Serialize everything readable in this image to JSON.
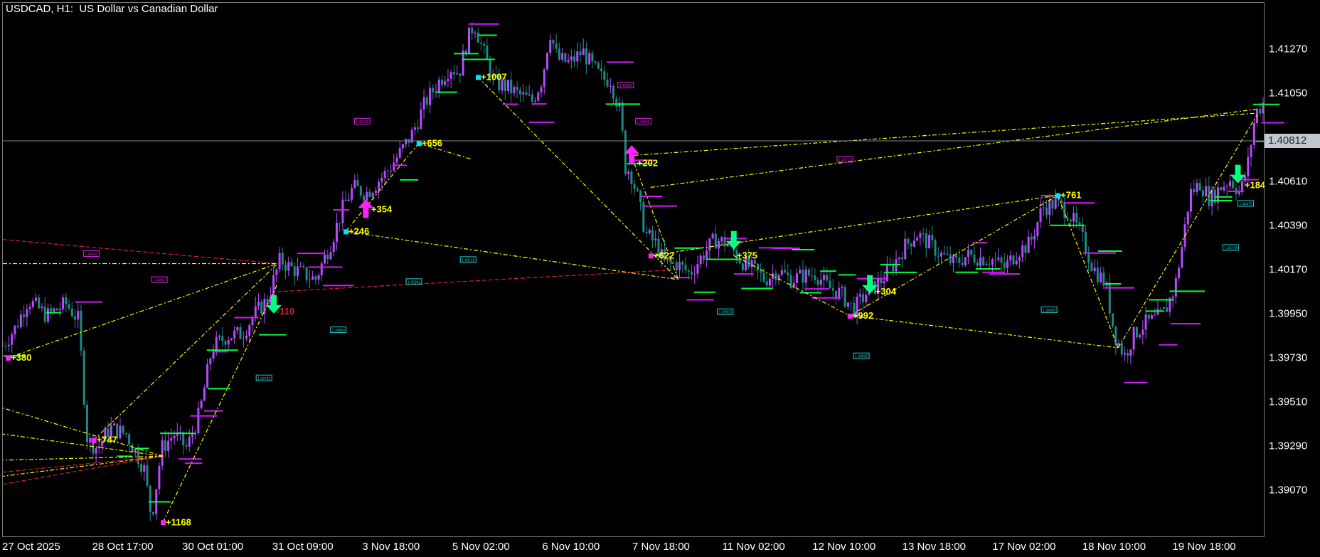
{
  "header": {
    "title": "USDCAD, H1:  US Dollar vs Canadian Dollar"
  },
  "colors": {
    "background": "#000000",
    "bull_candle": "#b44bff",
    "bear_candle": "#1f8a84",
    "zigzag": "#ffff00",
    "trend_red": "#d21e3c",
    "buy_level": "#00ff3c",
    "sell_level": "#d218ff",
    "signal_up": "#ff22ff",
    "signal_down": "#00ff7f",
    "label_text": "#ffff00",
    "current_price_line": "#778899"
  },
  "chart_data": {
    "type": "candlestick",
    "symbol": "USDCAD",
    "timeframe": "H1",
    "y_ticks": [
      "1.41270",
      "1.41050",
      "1.40610",
      "1.40390",
      "1.40170",
      "1.39950",
      "1.39730",
      "1.39510",
      "1.39290",
      "1.39070"
    ],
    "current_price": "1.40812",
    "x_ticks": [
      "27 Oct 2025",
      "28 Oct 17:00",
      "30 Oct 01:00",
      "31 Oct 09:00",
      "3 Nov 18:00",
      "5 Nov 02:00",
      "6 Nov 10:00",
      "7 Nov 18:00",
      "11 Nov 02:00",
      "12 Nov 10:00",
      "13 Nov 18:00",
      "17 Nov 02:00",
      "18 Nov 10:00",
      "19 Nov 18:00"
    ],
    "ylim": [
      1.3884,
      1.415
    ],
    "price_path": [
      [
        0,
        1.3979
      ],
      [
        0.01,
        1.3988
      ],
      [
        0.02,
        1.4002
      ],
      [
        0.035,
        1.3994
      ],
      [
        0.05,
        1.4
      ],
      [
        0.06,
        1.3992
      ],
      [
        0.067,
        1.3932
      ],
      [
        0.075,
        1.3928
      ],
      [
        0.085,
        1.3938
      ],
      [
        0.098,
        1.3935
      ],
      [
        0.112,
        1.3918
      ],
      [
        0.118,
        1.3893
      ],
      [
        0.126,
        1.3928
      ],
      [
        0.136,
        1.3935
      ],
      [
        0.146,
        1.3928
      ],
      [
        0.156,
        1.3945
      ],
      [
        0.166,
        1.3978
      ],
      [
        0.178,
        1.3984
      ],
      [
        0.19,
        1.3985
      ],
      [
        0.2,
        1.3995
      ],
      [
        0.21,
        1.4002
      ],
      [
        0.22,
        1.4022
      ],
      [
        0.228,
        1.4018
      ],
      [
        0.238,
        1.4015
      ],
      [
        0.248,
        1.4012
      ],
      [
        0.26,
        1.403
      ],
      [
        0.27,
        1.4048
      ],
      [
        0.278,
        1.4058
      ],
      [
        0.288,
        1.4055
      ],
      [
        0.296,
        1.406
      ],
      [
        0.305,
        1.4066
      ],
      [
        0.315,
        1.4075
      ],
      [
        0.325,
        1.4085
      ],
      [
        0.335,
        1.41
      ],
      [
        0.345,
        1.411
      ],
      [
        0.355,
        1.4118
      ],
      [
        0.362,
        1.4115
      ],
      [
        0.368,
        1.413
      ],
      [
        0.374,
        1.414
      ],
      [
        0.38,
        1.4128
      ],
      [
        0.39,
        1.411
      ],
      [
        0.4,
        1.4108
      ],
      [
        0.41,
        1.4104
      ],
      [
        0.42,
        1.4101
      ],
      [
        0.428,
        1.4112
      ],
      [
        0.434,
        1.4136
      ],
      [
        0.44,
        1.4122
      ],
      [
        0.45,
        1.412
      ],
      [
        0.46,
        1.4126
      ],
      [
        0.468,
        1.4118
      ],
      [
        0.476,
        1.4112
      ],
      [
        0.482,
        1.4112
      ],
      [
        0.49,
        1.4095
      ],
      [
        0.494,
        1.4068
      ],
      [
        0.498,
        1.4066
      ],
      [
        0.504,
        1.4052
      ],
      [
        0.51,
        1.4035
      ],
      [
        0.518,
        1.403
      ],
      [
        0.525,
        1.402
      ],
      [
        0.535,
        1.402
      ],
      [
        0.545,
        1.4015
      ],
      [
        0.555,
        1.4024
      ],
      [
        0.565,
        1.4032
      ],
      [
        0.575,
        1.403
      ],
      [
        0.585,
        1.4022
      ],
      [
        0.595,
        1.4017
      ],
      [
        0.605,
        1.4012
      ],
      [
        0.615,
        1.4017
      ],
      [
        0.625,
        1.4012
      ],
      [
        0.635,
        1.4014
      ],
      [
        0.645,
        1.4015
      ],
      [
        0.655,
        1.4008
      ],
      [
        0.665,
        1.4005
      ],
      [
        0.675,
        1.3997
      ],
      [
        0.685,
        1.4005
      ],
      [
        0.695,
        1.401
      ],
      [
        0.705,
        1.4018
      ],
      [
        0.715,
        1.4028
      ],
      [
        0.725,
        1.4035
      ],
      [
        0.735,
        1.403
      ],
      [
        0.745,
        1.4024
      ],
      [
        0.755,
        1.402
      ],
      [
        0.765,
        1.4024
      ],
      [
        0.775,
        1.4023
      ],
      [
        0.785,
        1.4022
      ],
      [
        0.795,
        1.4018
      ],
      [
        0.805,
        1.4026
      ],
      [
        0.815,
        1.403
      ],
      [
        0.825,
        1.4048
      ],
      [
        0.835,
        1.405
      ],
      [
        0.845,
        1.4046
      ],
      [
        0.855,
        1.4035
      ],
      [
        0.865,
        1.4018
      ],
      [
        0.875,
        1.401
      ],
      [
        0.882,
        1.3985
      ],
      [
        0.89,
        1.3974
      ],
      [
        0.898,
        1.3985
      ],
      [
        0.906,
        1.399
      ],
      [
        0.914,
        1.3992
      ],
      [
        0.922,
        1.3996
      ],
      [
        0.93,
        1.4008
      ],
      [
        0.936,
        1.403
      ],
      [
        0.942,
        1.4055
      ],
      [
        0.95,
        1.406
      ],
      [
        0.958,
        1.4052
      ],
      [
        0.966,
        1.4058
      ],
      [
        0.974,
        1.4062
      ],
      [
        0.982,
        1.4055
      ],
      [
        0.988,
        1.407
      ],
      [
        0.994,
        1.4095
      ],
      [
        1.0,
        1.41
      ]
    ],
    "zigzag_labels": [
      {
        "text": "+380",
        "x": 0.004,
        "y": 1.3973,
        "marker": "magenta"
      },
      {
        "text": "+747",
        "x": 0.072,
        "y": 1.3932,
        "marker": "magenta"
      },
      {
        "text": "+1168",
        "x": 0.127,
        "y": 1.3891,
        "marker": "magenta"
      },
      {
        "text": "-110",
        "x": 0.215,
        "y": 1.3996,
        "marker": "none"
      },
      {
        "text": "+246",
        "x": 0.272,
        "y": 1.4036,
        "marker": "cyan"
      },
      {
        "text": "+354",
        "x": 0.29,
        "y": 1.4047,
        "marker": "none"
      },
      {
        "text": "+656",
        "x": 0.33,
        "y": 1.408,
        "marker": "cyan"
      },
      {
        "text": "+1007",
        "x": 0.377,
        "y": 1.4113,
        "marker": "cyan"
      },
      {
        "text": "+202",
        "x": 0.501,
        "y": 1.407,
        "marker": "none"
      },
      {
        "text": "+622",
        "x": 0.514,
        "y": 1.4024,
        "marker": "magenta"
      },
      {
        "text": "+375",
        "x": 0.58,
        "y": 1.4024,
        "marker": "none"
      },
      {
        "text": "+992",
        "x": 0.672,
        "y": 1.3994,
        "marker": "magenta"
      },
      {
        "text": "+304",
        "x": 0.69,
        "y": 1.4006,
        "marker": "none"
      },
      {
        "text": "+761",
        "x": 0.837,
        "y": 1.4054,
        "marker": "cyan"
      },
      {
        "text": "+184",
        "x": 0.983,
        "y": 1.4059,
        "marker": "none"
      }
    ],
    "zigzag_lines": [
      [
        [
          0.004,
          1.3973
        ],
        [
          0.218,
          1.402
        ]
      ],
      [
        [
          0.072,
          1.3932
        ],
        [
          0.218,
          1.402
        ]
      ],
      [
        [
          0.127,
          1.3891
        ],
        [
          0.218,
          1.401
        ]
      ],
      [
        [
          0.127,
          1.3924
        ],
        [
          0.0,
          1.3948
        ]
      ],
      [
        [
          0.127,
          1.3924
        ],
        [
          0.0,
          1.3935
        ]
      ],
      [
        [
          0.127,
          1.3924
        ],
        [
          0.0,
          1.3922
        ]
      ],
      [
        [
          0.127,
          1.3924
        ],
        [
          0.0,
          1.3914
        ]
      ],
      [
        [
          0.0,
          1.402
        ],
        [
          0.218,
          1.402
        ]
      ],
      [
        [
          0.272,
          1.4036
        ],
        [
          0.536,
          1.4012
        ]
      ],
      [
        [
          0.33,
          1.408
        ],
        [
          0.372,
          1.4072
        ]
      ],
      [
        [
          0.33,
          1.408
        ],
        [
          0.272,
          1.4036
        ]
      ],
      [
        [
          0.377,
          1.4113
        ],
        [
          0.536,
          1.4012
        ]
      ],
      [
        [
          0.501,
          1.407
        ],
        [
          0.536,
          1.4012
        ]
      ],
      [
        [
          0.501,
          1.4074
        ],
        [
          0.995,
          1.4095
        ]
      ],
      [
        [
          0.514,
          1.4024
        ],
        [
          0.837,
          1.4054
        ]
      ],
      [
        [
          0.837,
          1.4054
        ],
        [
          0.885,
          1.3978
        ]
      ],
      [
        [
          0.672,
          1.3994
        ],
        [
          0.837,
          1.4054
        ]
      ],
      [
        [
          0.58,
          1.4024
        ],
        [
          0.672,
          1.3994
        ]
      ],
      [
        [
          0.885,
          1.3978
        ],
        [
          0.995,
          1.4094
        ]
      ],
      [
        [
          0.514,
          1.4058
        ],
        [
          0.995,
          1.4097
        ]
      ],
      [
        [
          0.672,
          1.3994
        ],
        [
          0.885,
          1.3978
        ]
      ]
    ],
    "red_lines": [
      [
        [
          0.0,
          1.4032
        ],
        [
          0.218,
          1.402
        ]
      ],
      [
        [
          0.0,
          1.391
        ],
        [
          0.127,
          1.3924
        ]
      ],
      [
        [
          0.0,
          1.3916
        ],
        [
          0.127,
          1.3924
        ]
      ],
      [
        [
          0.218,
          1.4006
        ],
        [
          0.536,
          1.4017
        ]
      ]
    ],
    "signal_arrows": [
      {
        "dir": "up",
        "x": 0.288,
        "y": 1.4047
      },
      {
        "dir": "down",
        "x": 0.215,
        "y": 1.4
      },
      {
        "dir": "up",
        "x": 0.499,
        "y": 1.4074
      },
      {
        "dir": "down",
        "x": 0.58,
        "y": 1.4032
      },
      {
        "dir": "down",
        "x": 0.688,
        "y": 1.401
      },
      {
        "dir": "down",
        "x": 0.98,
        "y": 1.4065
      }
    ],
    "level_boxes": [
      {
        "text": "1.40690",
        "x": 0.279,
        "y": 1.4091,
        "color": "magenta"
      },
      {
        "text": "1.40430",
        "x": 0.064,
        "y": 1.4025,
        "color": "magenta"
      },
      {
        "text": "1.40218",
        "x": 0.363,
        "y": 1.4022,
        "color": "cyan"
      },
      {
        "text": "1.40064",
        "x": 0.32,
        "y": 1.4011,
        "color": "cyan"
      },
      {
        "text": "1.40007",
        "x": 0.118,
        "y": 1.4012,
        "color": "magenta"
      },
      {
        "text": "1.39850",
        "x": 0.26,
        "y": 1.3987,
        "color": "cyan"
      },
      {
        "text": "1.39723",
        "x": 0.201,
        "y": 1.3963,
        "color": "cyan"
      },
      {
        "text": "1.40986",
        "x": 0.488,
        "y": 1.4109,
        "color": "magenta"
      },
      {
        "text": "1.40846",
        "x": 0.502,
        "y": 1.4091,
        "color": "magenta"
      },
      {
        "text": "1.40717",
        "x": 0.662,
        "y": 1.4072,
        "color": "magenta"
      },
      {
        "text": "1.39950",
        "x": 0.567,
        "y": 1.3996,
        "color": "cyan"
      },
      {
        "text": "1.39698",
        "x": 0.675,
        "y": 1.3974,
        "color": "cyan"
      },
      {
        "text": "1.39965",
        "x": 0.824,
        "y": 1.3997,
        "color": "cyan"
      },
      {
        "text": "1.40278",
        "x": 0.968,
        "y": 1.4028,
        "color": "cyan"
      },
      {
        "text": "1.40475",
        "x": 0.98,
        "y": 1.405,
        "color": "cyan"
      }
    ]
  }
}
